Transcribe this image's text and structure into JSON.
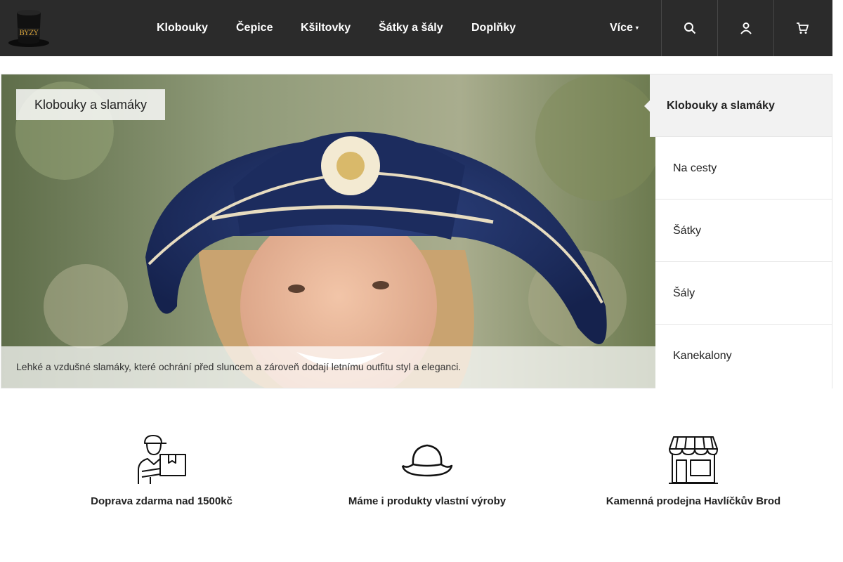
{
  "header": {
    "logo_text": "BYZY",
    "nav": [
      {
        "label": "Klobouky"
      },
      {
        "label": "Čepice"
      },
      {
        "label": "Kšiltovky"
      },
      {
        "label": "Šátky a šály"
      },
      {
        "label": "Doplňky"
      }
    ],
    "more_label": "Více",
    "buttons": [
      {
        "icon": "search-icon"
      },
      {
        "icon": "user-icon"
      },
      {
        "icon": "cart-icon"
      }
    ]
  },
  "banner": {
    "title": "Klobouky a slamáky",
    "caption": "Lehké a vzdušné slamáky, které ochrání před sluncem a zároveň dodají letnímu outfitu styl a eleganci."
  },
  "side_menu": {
    "items": [
      {
        "label": "Klobouky a slamáky",
        "active": true
      },
      {
        "label": "Na cesty"
      },
      {
        "label": "Šátky"
      },
      {
        "label": "Šály"
      },
      {
        "label": "Kanekalony"
      }
    ]
  },
  "features": [
    {
      "icon": "delivery-person-icon",
      "label": "Doprava zdarma nad 1500kč"
    },
    {
      "icon": "hat-icon",
      "label": "Máme i produkty vlastní výroby"
    },
    {
      "icon": "store-icon",
      "label": "Kamenná prodejna Havlíčkův Brod"
    }
  ],
  "colors": {
    "header_bg": "#2b2b2b",
    "hat_blue": "#1f2f63",
    "side_active_bg": "#f2f2f2"
  }
}
